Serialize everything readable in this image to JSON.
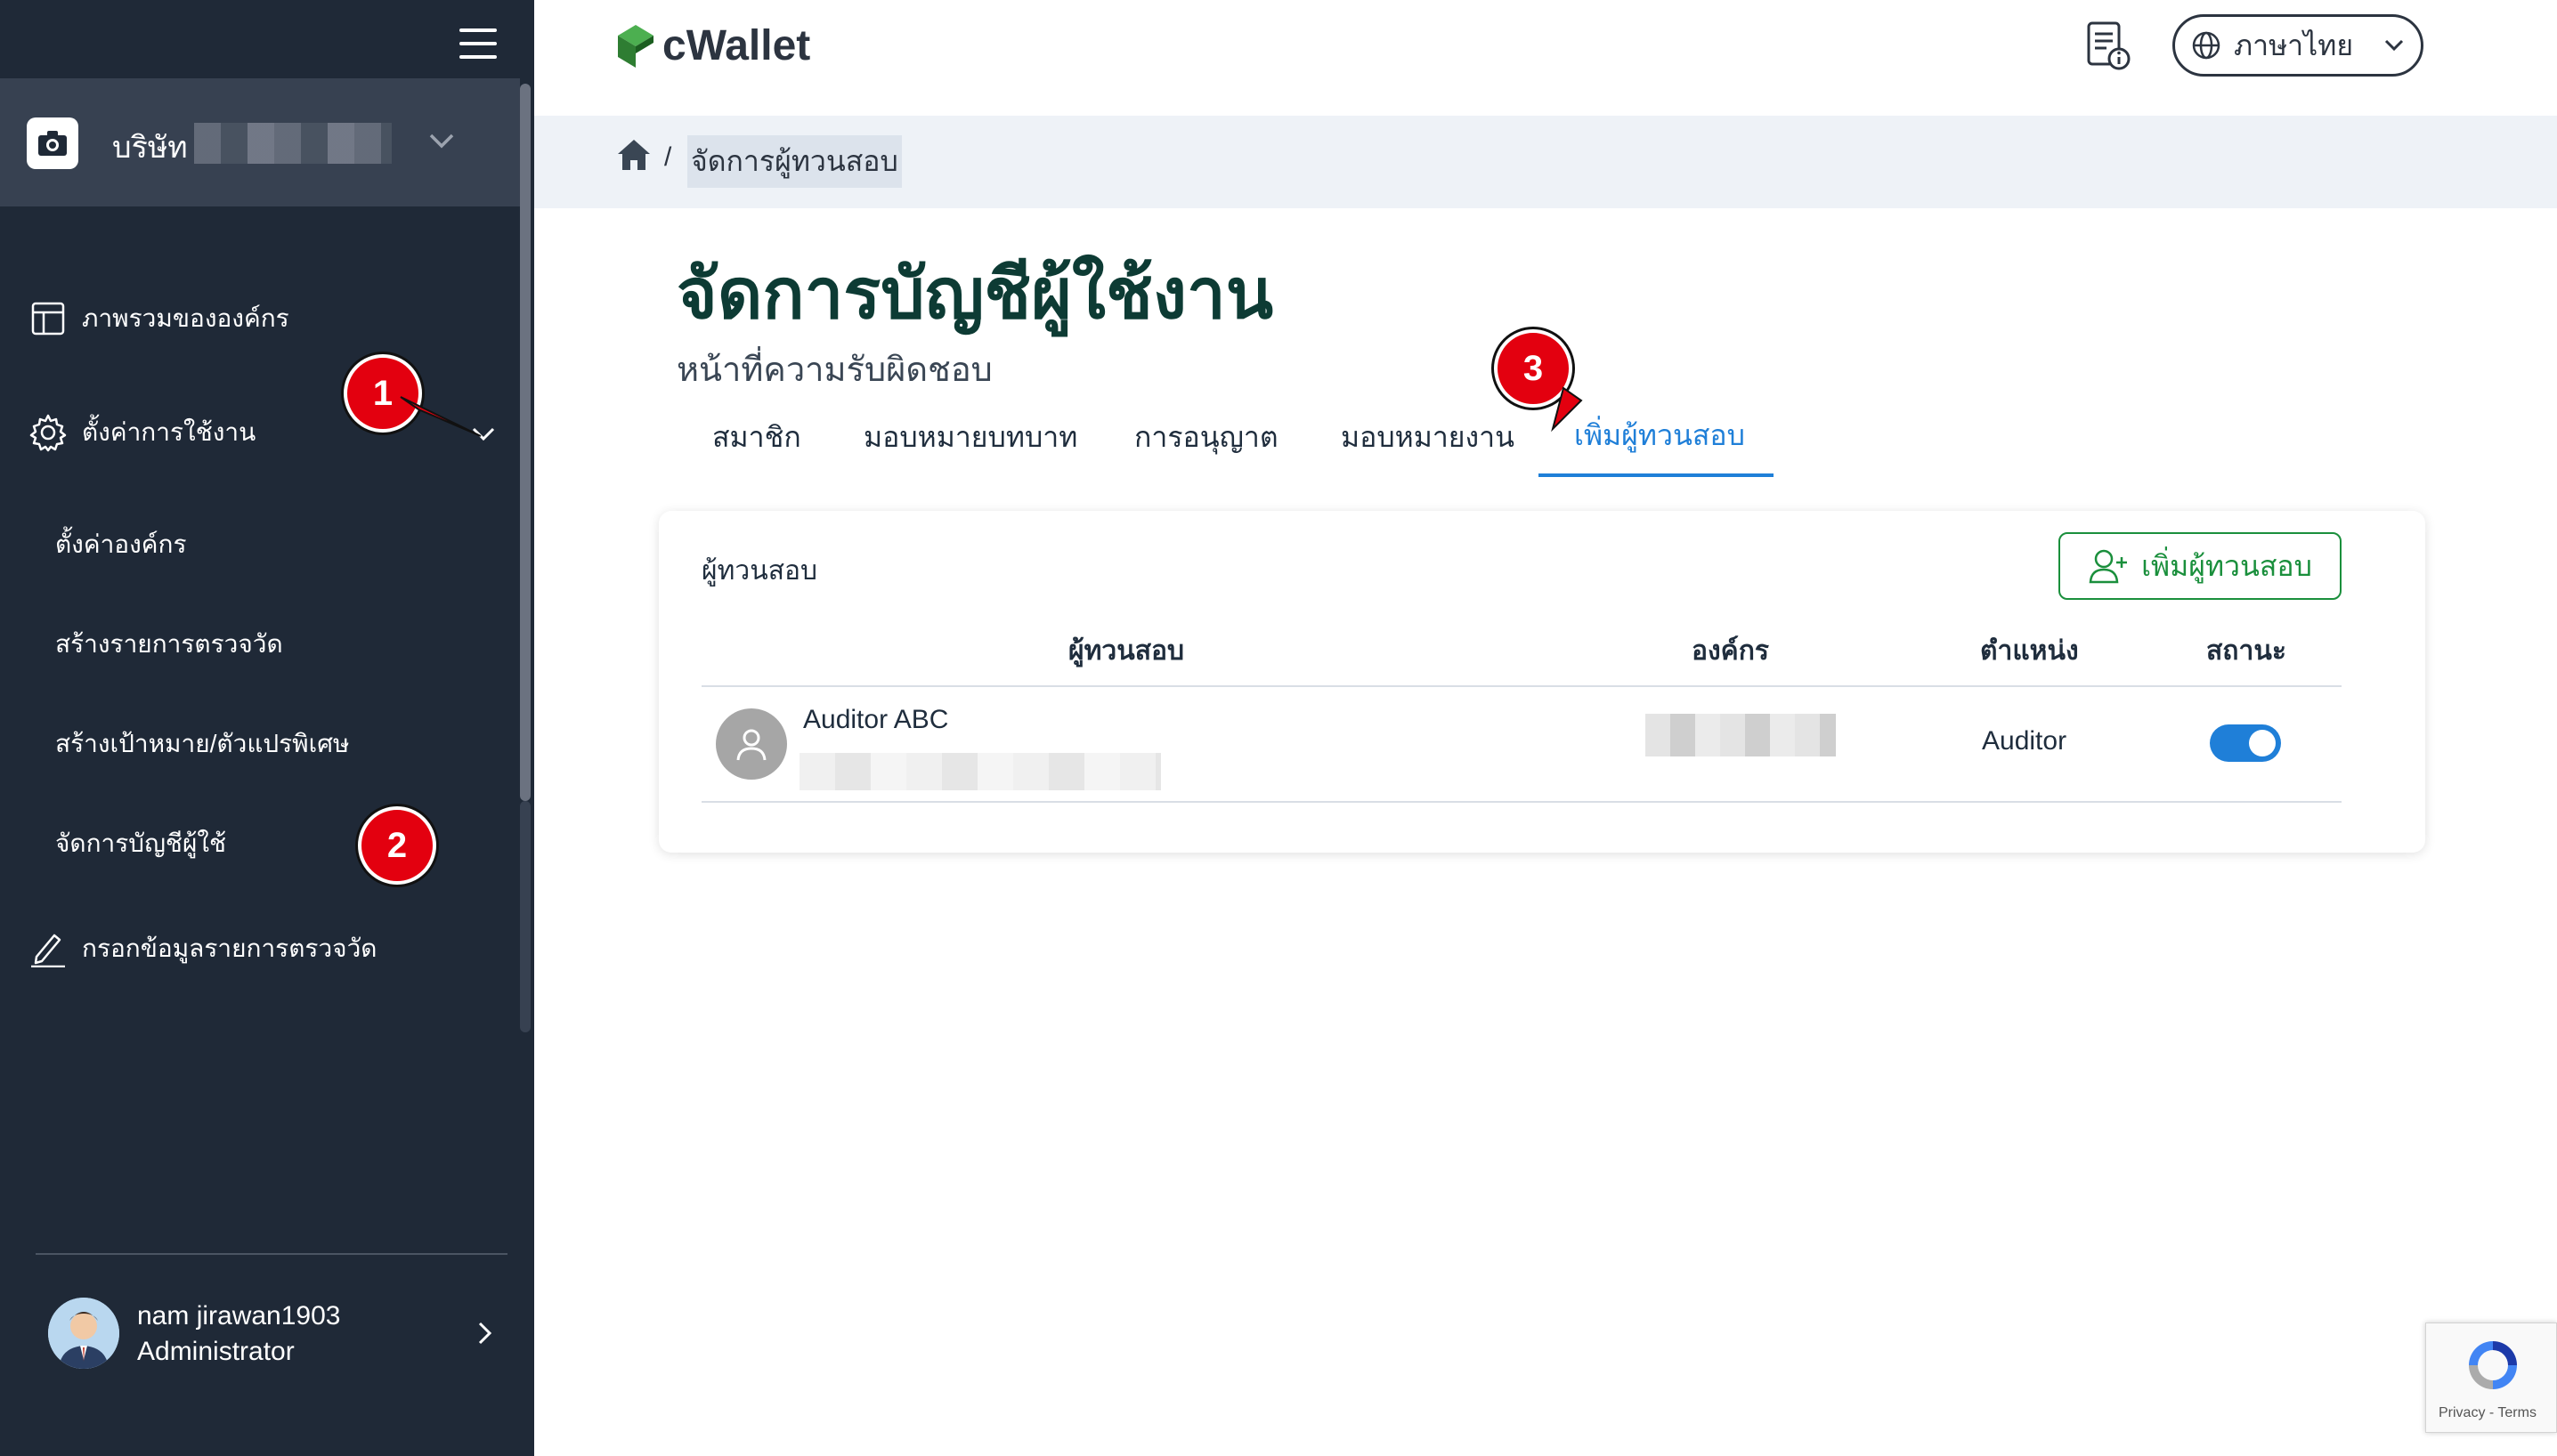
{
  "sidebar": {
    "company_label": "บริษัท",
    "nav": {
      "overview": "ภาพรวมขององค์กร",
      "settings": "ตั้งค่าการใช้งาน",
      "sub": {
        "org_settings": "ตั้งค่าองค์กร",
        "create_inspection": "สร้างรายการตรวจวัด",
        "create_target": "สร้างเป้าหมาย/ตัวแปรพิเศษ",
        "manage_accounts": "จัดการบัญชีผู้ใช้"
      },
      "fill_data": "กรอกข้อมูลรายการตรวจวัด"
    },
    "user": {
      "name": "nam jirawan1903",
      "role": "Administrator"
    }
  },
  "badges": {
    "b1": "1",
    "b2": "2",
    "b3": "3"
  },
  "topbar": {
    "logo": "cWallet",
    "language": "ภาษาไทย"
  },
  "breadcrumb": {
    "current": "จัดการผู้ทวนสอบ",
    "separator": "/"
  },
  "page": {
    "title": "จัดการบัญชีผู้ใช้งาน",
    "subtitle": "หน้าที่ความรับผิดชอบ",
    "tabs": [
      "สมาชิก",
      "มอบหมายบทบาท",
      "การอนุญาต",
      "มอบหมายงาน",
      "เพิ่มผู้ทวนสอบ"
    ],
    "active_tab": "เพิ่มผู้ทวนสอบ"
  },
  "card": {
    "title": "ผู้ทวนสอบ",
    "add_button": "เพิ่มผู้ทวนสอบ",
    "columns": [
      "ผู้ทวนสอบ",
      "องค์กร",
      "ตำแหน่ง",
      "สถานะ"
    ],
    "rows": [
      {
        "name": "Auditor ABC",
        "position": "Auditor",
        "status_on": true
      }
    ]
  },
  "recaptcha": {
    "text": "Privacy - Terms"
  },
  "colors": {
    "sidebar_bg": "#1f2937",
    "accent_blue": "#1f7fd8",
    "accent_green": "#1a8f3c",
    "badge_red": "#e3000f",
    "title_green": "#0d3b34"
  }
}
